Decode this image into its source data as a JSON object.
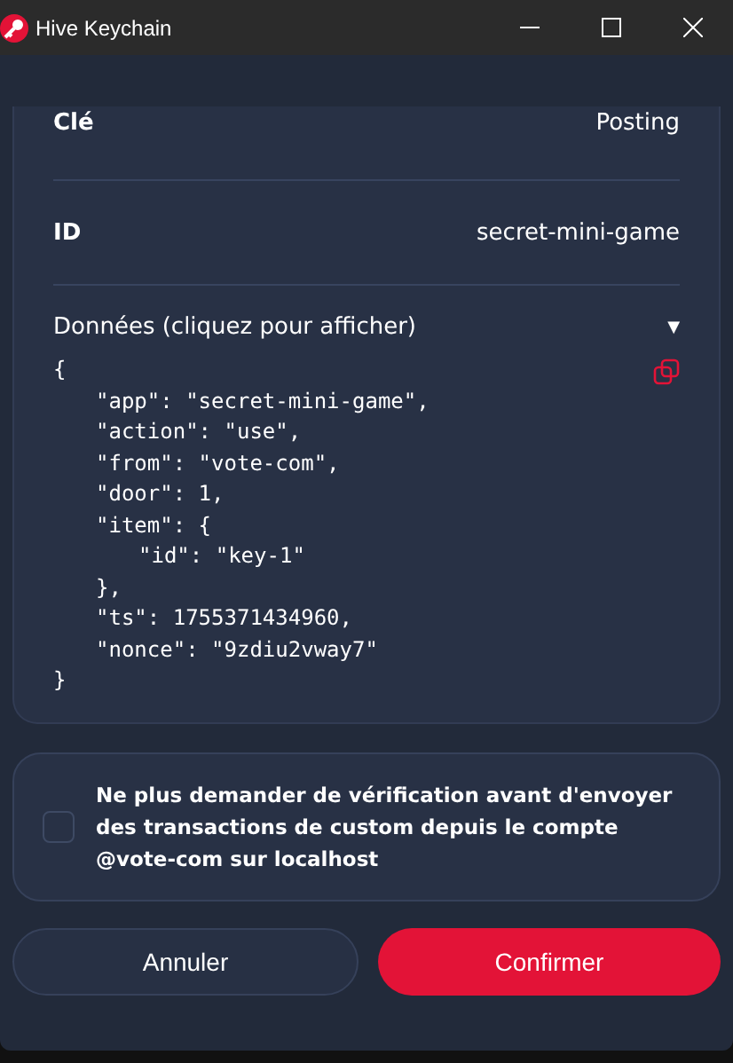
{
  "window": {
    "title": "Hive Keychain"
  },
  "details": [
    {
      "label": "Clé",
      "value": "Posting"
    },
    {
      "label": "ID",
      "value": "secret-mini-game"
    }
  ],
  "data_section": {
    "label": "Données (cliquez pour afficher)",
    "expanded": true,
    "caret": "▼",
    "lines": [
      {
        "text": "{",
        "children": [
          {
            "text": "\"app\": \"secret-mini-game\","
          },
          {
            "text": "\"action\": \"use\","
          },
          {
            "text": "\"from\": \"vote-com\","
          },
          {
            "text": "\"door\": 1,"
          },
          {
            "text": "\"item\": {",
            "children": [
              {
                "text": "\"id\": \"key-1\""
              }
            ]
          },
          {
            "text": "},"
          },
          {
            "text": "\"ts\": 1755371434960,"
          },
          {
            "text": "\"nonce\": \"9zdiu2vway7\""
          }
        ]
      },
      {
        "text": "}"
      }
    ]
  },
  "no_confirm": {
    "label": "Ne plus demander de vérification avant d'envoyer des transactions de custom depuis le compte @vote-com sur localhost",
    "checked": false
  },
  "buttons": [
    {
      "label": "Annuler",
      "kind": "secondary"
    },
    {
      "label": "Confirmer",
      "kind": "primary"
    }
  ]
}
